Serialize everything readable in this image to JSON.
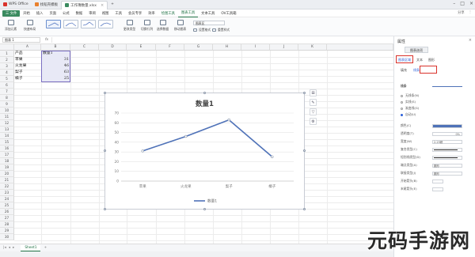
{
  "tabs": [
    {
      "label": "WPS Office",
      "color": "#d9322b"
    },
    {
      "label": "找稻壳模板",
      "color": "#e8802d"
    },
    {
      "label": "工作簿数量.xlsx",
      "color": "#3a8a5f",
      "active": true
    }
  ],
  "menu": {
    "items": [
      "三 文件",
      "开始",
      "插入",
      "页面",
      "公式",
      "数据",
      "审阅",
      "视图",
      "工具",
      "会员专享",
      "效率",
      "绘图工具",
      "图表工具",
      "文本工具",
      "OV工具箱"
    ],
    "highlight_index": 12,
    "right": [
      "分享",
      "⋮"
    ]
  },
  "ribbon": {
    "add_element": "添加元素",
    "quick_layout": "快速布局",
    "change_type": "更改类型",
    "switch_rowcol": "切换行列",
    "select_data": "选择数据",
    "move_chart": "移动图表",
    "select_label": "图表区",
    "set_format": "设置格式",
    "reset_style": "重置样式"
  },
  "formula": {
    "name_box": "图表 1",
    "fx": "fx"
  },
  "columns": [
    "A",
    "B",
    "C",
    "D",
    "E",
    "F",
    "G",
    "H",
    "I",
    "J",
    "K"
  ],
  "rows": [
    "1",
    "2",
    "3",
    "4",
    "5",
    "6",
    "7",
    "8",
    "9",
    "10",
    "11",
    "12",
    "13",
    "14",
    "15",
    "16",
    "17",
    "18",
    "19",
    "20",
    "21",
    "22",
    "23",
    "24",
    "25",
    "26",
    "27",
    "28",
    "29",
    "30"
  ],
  "cells": {
    "A1": "产品",
    "B1": "数量1",
    "A2": "苹果",
    "B2": "31",
    "A3": "火龙果",
    "B3": "46",
    "A4": "梨子",
    "B4": "63",
    "A5": "橘子",
    "B5": "25"
  },
  "chart_data": {
    "type": "line",
    "title": "数量1",
    "categories": [
      "苹果",
      "火龙果",
      "梨子",
      "橘子"
    ],
    "series": [
      {
        "name": "数量1",
        "values": [
          31,
          46,
          63,
          25
        ],
        "color": "#4f72b8"
      }
    ],
    "ylim": [
      0,
      70
    ],
    "yticks": [
      0,
      10,
      20,
      30,
      40,
      50,
      60,
      70
    ],
    "grid": true,
    "legend": "bottom"
  },
  "sheet": {
    "name": "Sheet1",
    "add": "+"
  },
  "panel": {
    "title": "属性",
    "close": "×",
    "main_tab": "图表选项",
    "subtabs": [
      "图表区域",
      "文本",
      "图形"
    ],
    "fill_tabs": [
      "填充",
      "线条"
    ],
    "section": "线条",
    "line_options": [
      "无线条(N)",
      "实线(S)",
      "渐变线(G)",
      "自动(U)"
    ],
    "props": [
      {
        "label": "颜色(C)",
        "value": ""
      },
      {
        "label": "透明度(T)",
        "value": "0%"
      },
      {
        "label": "宽度(W)",
        "value": "2.25磅"
      },
      {
        "label": "复合类型(C)",
        "value": ""
      },
      {
        "label": "短划线类型(D)",
        "value": ""
      },
      {
        "label": "端点类型(A)",
        "value": "圆形"
      },
      {
        "label": "联接类型(J)",
        "value": "圆形"
      },
      {
        "label": "开始箭头(B)",
        "value": ""
      },
      {
        "label": "末尾箭头(E)",
        "value": ""
      }
    ]
  },
  "watermark": "元码手游网"
}
